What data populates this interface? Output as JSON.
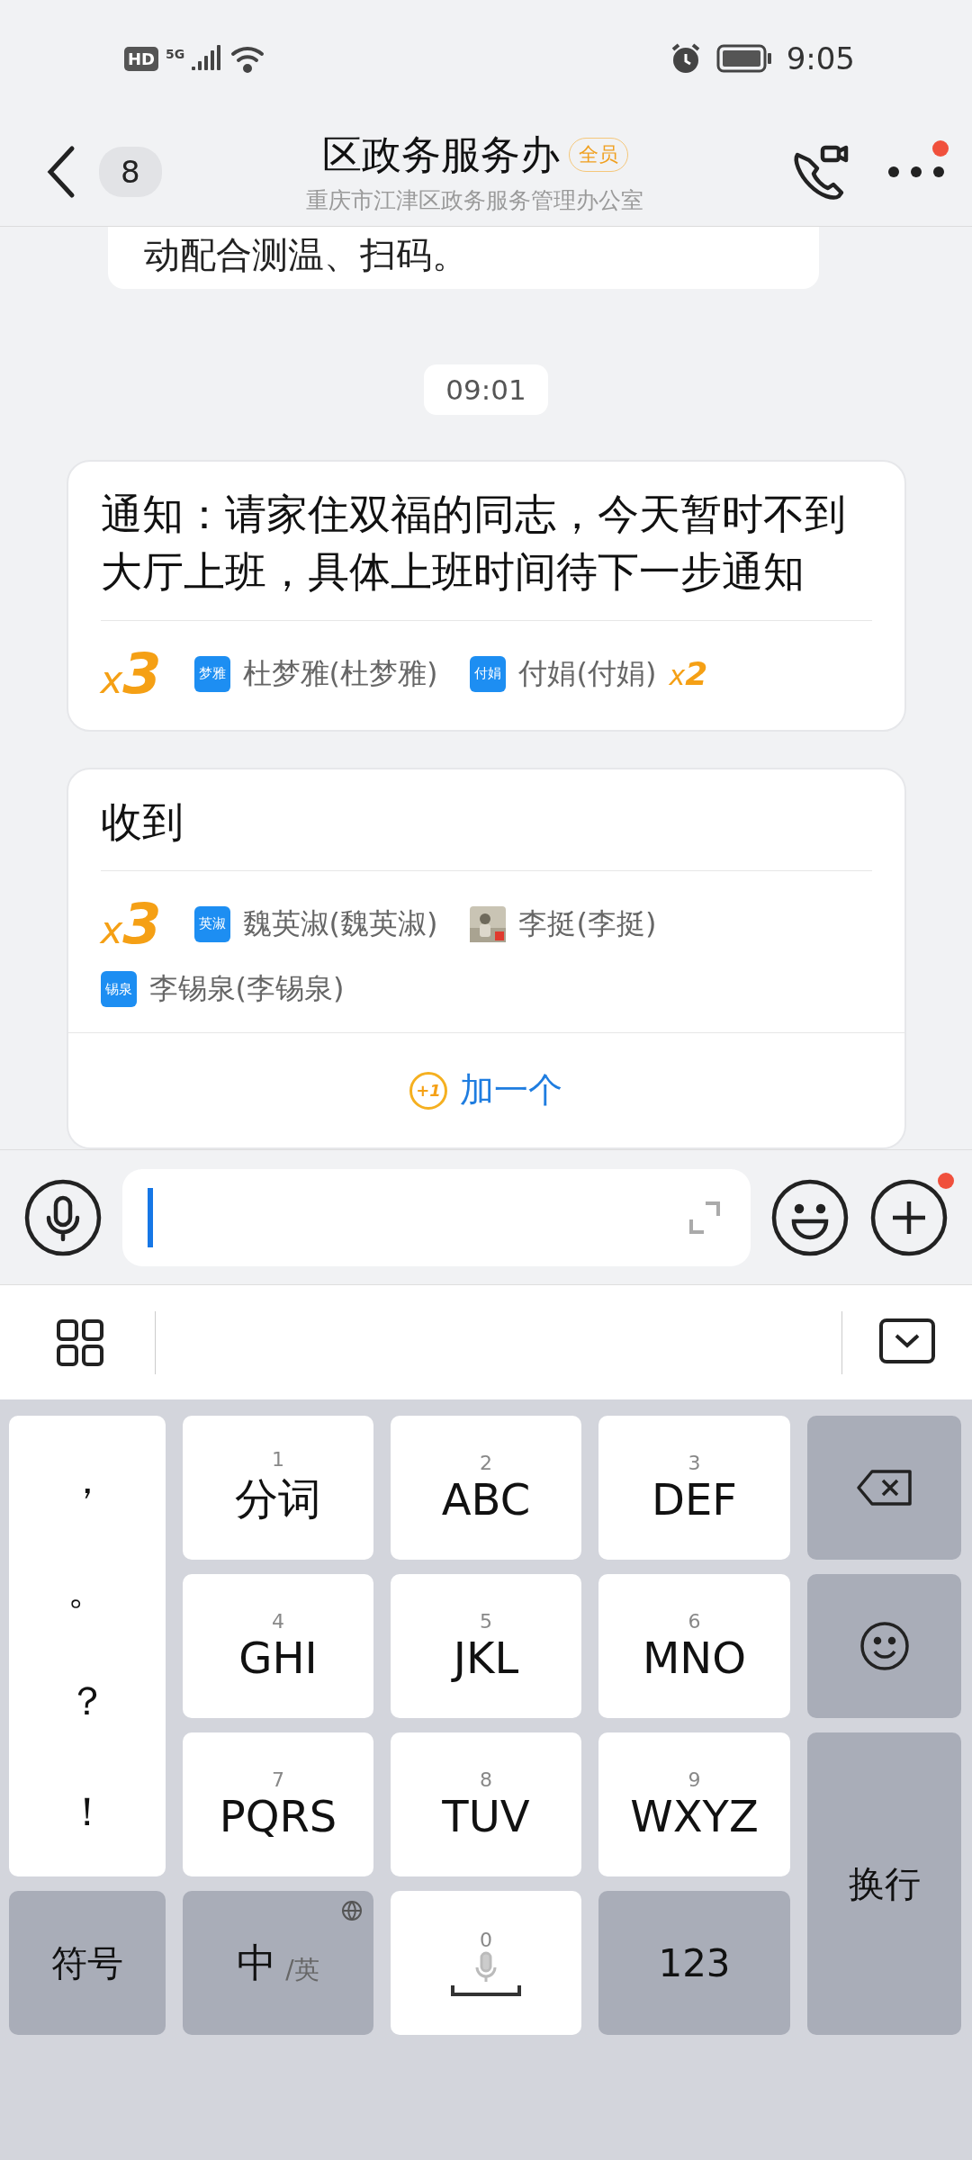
{
  "status_bar": {
    "hd": "HD",
    "network": "5G",
    "time": "9:05"
  },
  "header": {
    "back_count": "8",
    "title": "区政务服务办",
    "badge": "全员",
    "subtitle": "重庆市江津区政务服务管理办公室",
    "more_notification": true
  },
  "messages": [
    {
      "kind": "fragment",
      "text": "动配合测温、扫码。"
    },
    {
      "kind": "time",
      "text": "09:01"
    },
    {
      "kind": "receipt",
      "text": "通知：请家住双福的同志，今天暂时不到大厅上班，具体上班时间待下一步通知",
      "count_mark": "x",
      "count": "3",
      "reactors": [
        {
          "kind": "initials",
          "avatar_text": "梦雅",
          "name": "杜梦雅(杜梦雅)"
        },
        {
          "kind": "initials",
          "avatar_text": "付娟",
          "name": "付娟(付娟)",
          "multiplier_mark": "x",
          "multiplier": "2"
        }
      ]
    },
    {
      "kind": "receipt",
      "text": "收到",
      "count_mark": "x",
      "count": "3",
      "reactors": [
        {
          "kind": "initials",
          "avatar_text": "英淑",
          "name": "魏英淑(魏英淑)"
        },
        {
          "kind": "picture",
          "name": "李挺(李挺)"
        },
        {
          "kind": "initials",
          "avatar_text": "锡泉",
          "name": "李锡泉(李锡泉)"
        }
      ],
      "action": {
        "icon_text": "+1",
        "label": "加一个"
      }
    }
  ],
  "input": {
    "plus_notification": true
  },
  "keyboard": {
    "punctuation": [
      "，",
      "。",
      "？",
      "！"
    ],
    "keys": [
      {
        "number": "1",
        "label": "分词"
      },
      {
        "number": "2",
        "label": "ABC"
      },
      {
        "number": "3",
        "label": "DEF"
      },
      {
        "number": "4",
        "label": "GHI"
      },
      {
        "number": "5",
        "label": "JKL"
      },
      {
        "number": "6",
        "label": "MNO"
      },
      {
        "number": "7",
        "label": "PQRS"
      },
      {
        "number": "8",
        "label": "TUV"
      },
      {
        "number": "9",
        "label": "WXYZ"
      }
    ],
    "symbols": "符号",
    "lang_main": "中",
    "lang_alt": "/英",
    "space_number": "0",
    "numbers": "123",
    "enter": "换行"
  }
}
